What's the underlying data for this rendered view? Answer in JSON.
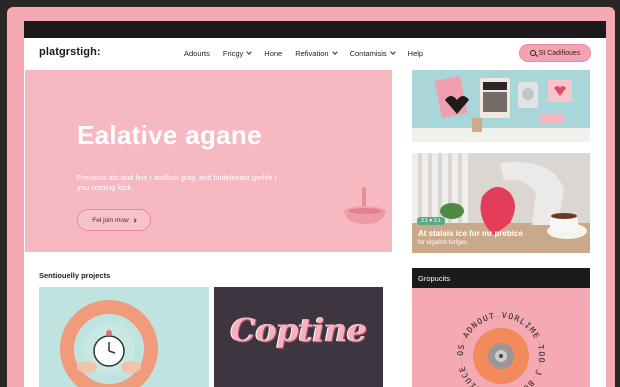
{
  "app": {
    "logo": "platgrstigh:"
  },
  "nav": {
    "items": [
      {
        "label": "Adourts",
        "has_dropdown": false
      },
      {
        "label": "Fricgy",
        "has_dropdown": true
      },
      {
        "label": "Hone",
        "has_dropdown": false
      },
      {
        "label": "Refivation",
        "has_dropdown": true
      },
      {
        "label": "Contamisis",
        "has_dropdown": true
      },
      {
        "label": "Help",
        "has_dropdown": false
      }
    ],
    "cta_label": "St Cadifioues"
  },
  "hero": {
    "title": "Ealative agane",
    "subtitle": "Prevents ats and fine I andfark gray, and hintelesant gerlife I you coming look.",
    "button_label": "Fel join mow"
  },
  "feature_cards": [
    {
      "image_icon": "pink-gadgets-shelf-icon"
    },
    {
      "badge": "3.1  ♥ 3.1",
      "title": "At stalsis ice for mr prebice",
      "subtitle": "for elgalish forfges."
    }
  ],
  "projects": {
    "title": "Sentiouelly projects",
    "tiles": [
      {
        "image_icon": "clock-ring-icon"
      },
      {
        "text": "Coptine"
      }
    ]
  },
  "groups": {
    "title": "Gropucits",
    "ring_text": "OS ADNOUT VORLIME TOO J BOUNDE MORIUCE"
  },
  "colors": {
    "frame": "#f4a9b3",
    "hero": "#f6b8c1",
    "dark": "#1c1a1b",
    "accent": "#f4a3b2",
    "teal": "#a6d5d7"
  }
}
